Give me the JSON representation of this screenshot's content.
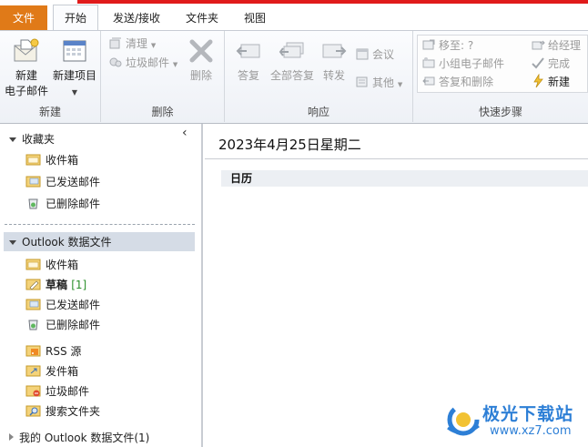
{
  "tabs": [
    {
      "label": "文件"
    },
    {
      "label": "开始"
    },
    {
      "label": "发送/接收"
    },
    {
      "label": "文件夹"
    },
    {
      "label": "视图"
    }
  ],
  "ribbon": {
    "new_group": {
      "label": "新建",
      "new_email": "新建\n电子邮件",
      "new_email_line1": "新建",
      "new_email_line2": "电子邮件",
      "new_items": "新建项目"
    },
    "delete_group": {
      "label": "删除",
      "clean": "清理",
      "junk": "垃圾邮件",
      "delete": "删除"
    },
    "respond_group": {
      "label": "响应",
      "reply": "答复",
      "reply_all": "全部答复",
      "forward": "转发",
      "meeting": "会议",
      "more": "其他"
    },
    "quicksteps_group": {
      "label": "快速步骤",
      "move_to": "移至: ?",
      "team_email": "小组电子邮件",
      "reply_delete": "答复和删除",
      "to_manager": "给经理",
      "done": "完成",
      "create_new": "新建"
    }
  },
  "nav": {
    "collapse_glyph": "‹",
    "favorites": {
      "label": "收藏夹",
      "items": [
        "收件箱",
        "已发送邮件",
        "已删除邮件"
      ]
    },
    "account": {
      "label": "Outlook 数据文件",
      "items": [
        {
          "label": "收件箱",
          "count": ""
        },
        {
          "label": "草稿",
          "count": "[1]"
        },
        {
          "label": "已发送邮件",
          "count": ""
        },
        {
          "label": "已删除邮件",
          "count": ""
        },
        {
          "label": "RSS 源",
          "count": ""
        },
        {
          "label": "发件箱",
          "count": ""
        },
        {
          "label": "垃圾邮件",
          "count": ""
        },
        {
          "label": "搜索文件夹",
          "count": ""
        }
      ]
    },
    "other_account": "我的 Outlook 数据文件(1)"
  },
  "main": {
    "date_title": "2023年4月25日星期二",
    "calendar_label": "日历"
  },
  "watermark": {
    "title": "极光下载站",
    "url": "www.xz7.com"
  },
  "colors": {
    "file_tab": "#e07a18",
    "red_accent": "#e01b1b",
    "selection": "#d5dce6",
    "draft_count": "#2a8f2a",
    "watermark": "#2d7fd6"
  }
}
